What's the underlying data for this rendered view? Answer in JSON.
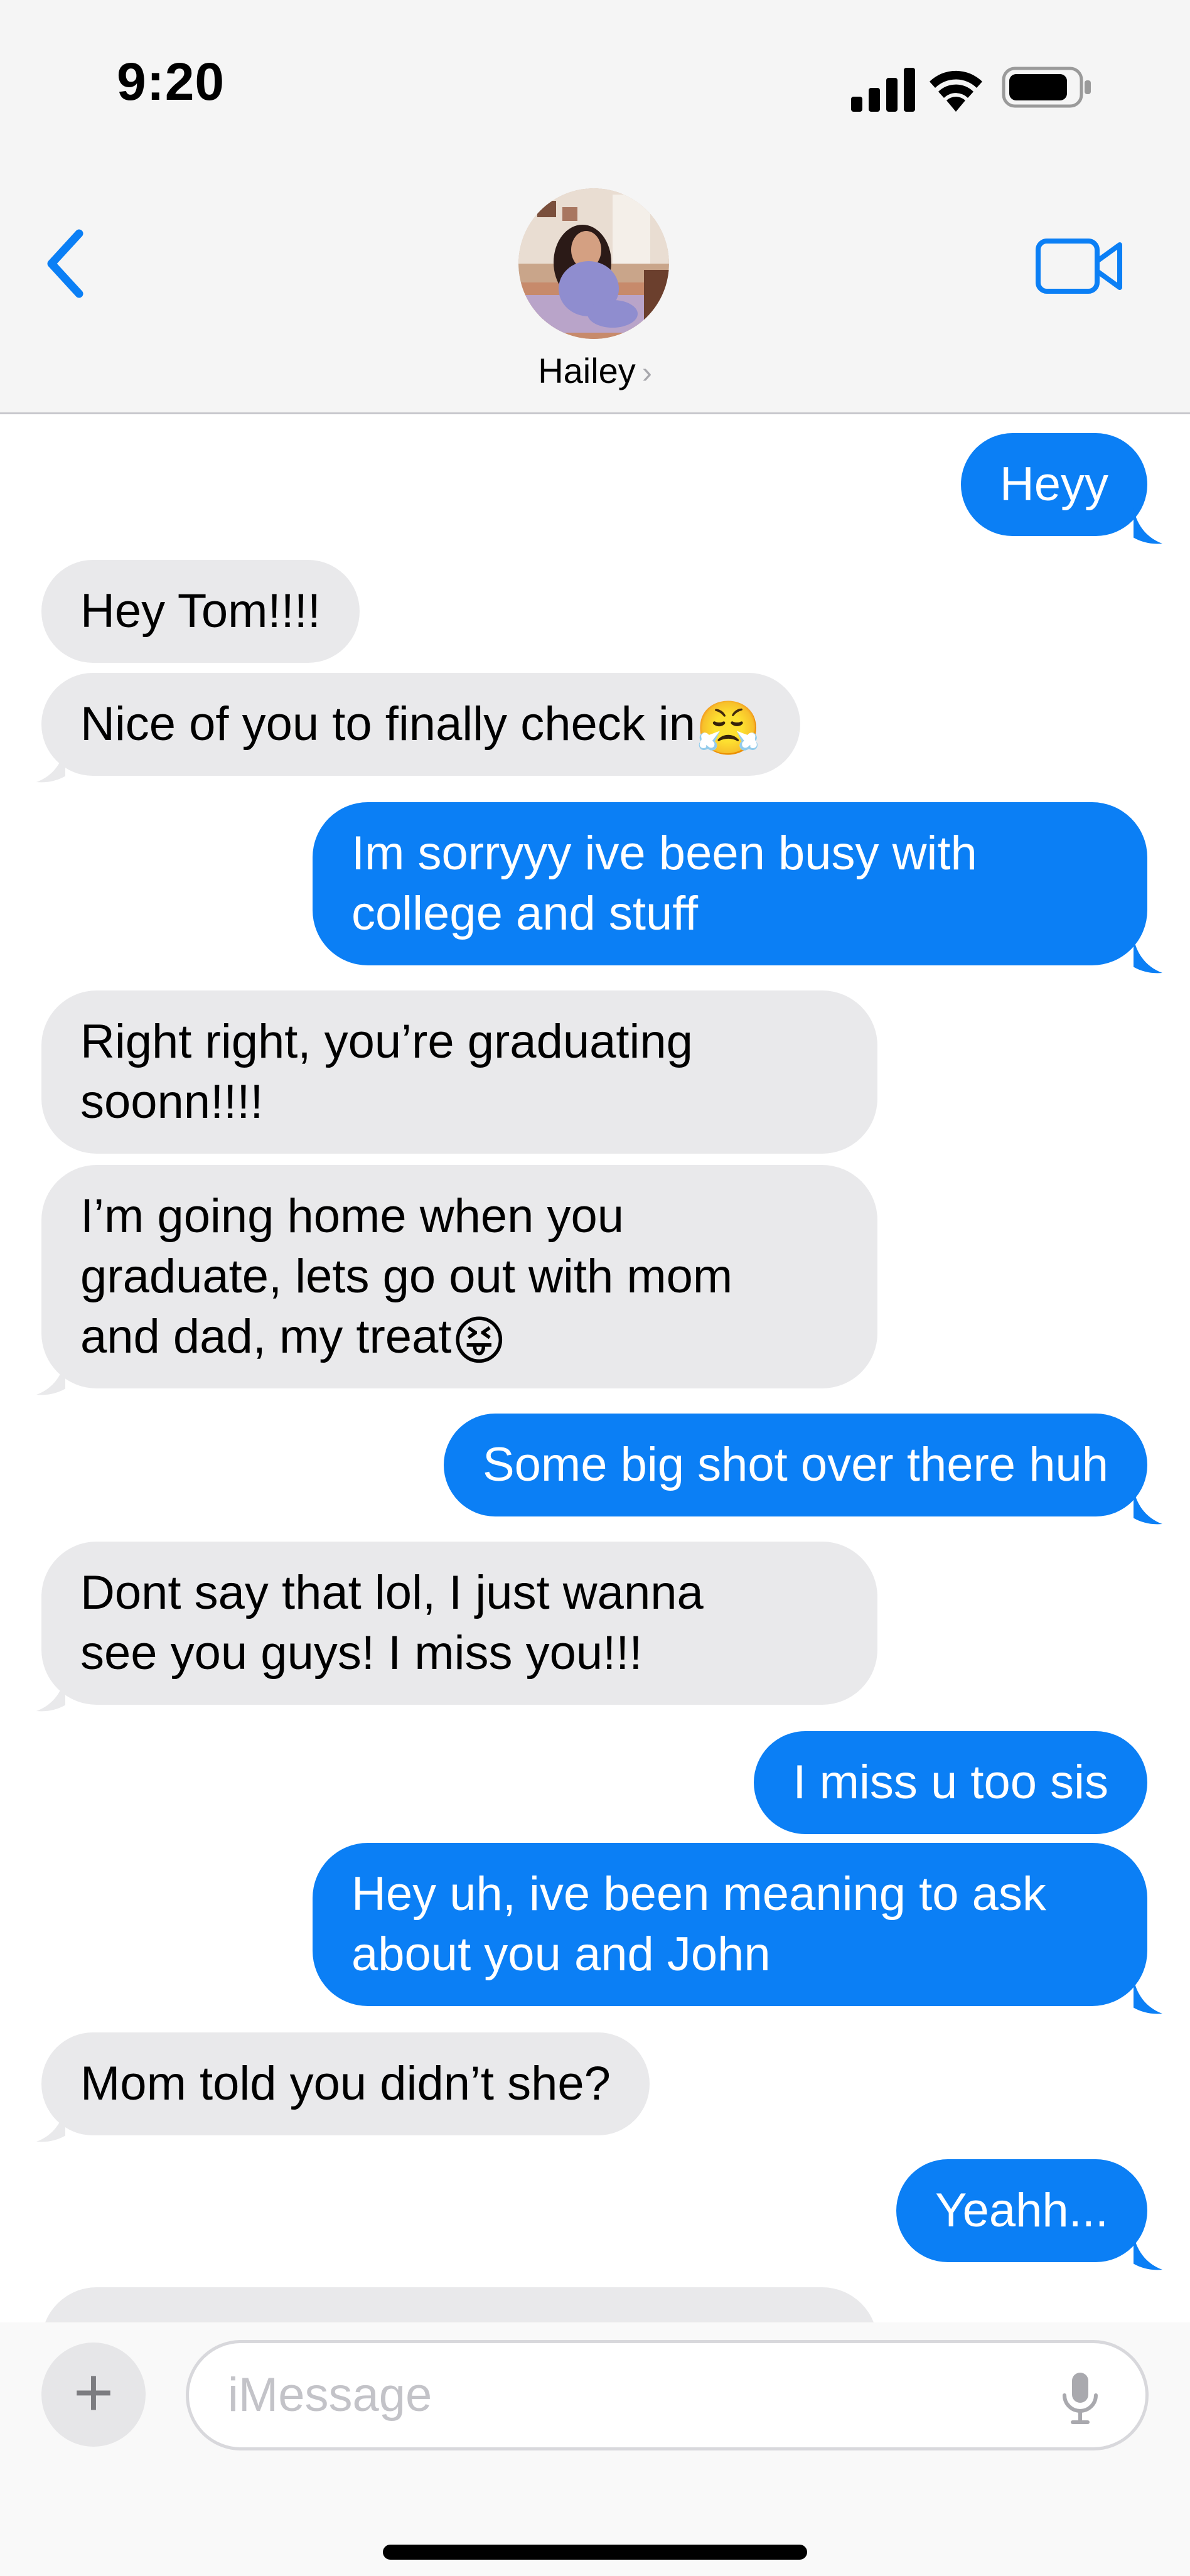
{
  "status_bar": {
    "time": "9:20",
    "icons": [
      "signal-icon",
      "wifi-icon",
      "battery-icon"
    ]
  },
  "header": {
    "back_icon": "chevron-left-icon",
    "contact_name": "Hailey",
    "contact_chevron": "›",
    "video_icon": "video-camera-icon"
  },
  "messages": [
    {
      "side": "sent",
      "text": "Heyy"
    },
    {
      "side": "received",
      "text": "Hey Tom!!!!"
    },
    {
      "side": "received",
      "text": "Nice of you to finally check in",
      "emoji": "😤"
    },
    {
      "side": "sent",
      "lines": [
        "Im sorryyy ive been busy with",
        "college and stuff"
      ]
    },
    {
      "side": "received",
      "lines": [
        "Right right, you’re graduating",
        "soonn!!!!"
      ]
    },
    {
      "side": "received",
      "lines": [
        "I’m going home when you",
        "graduate, lets go out with mom",
        "and dad, my treat"
      ],
      "emoji": "😝"
    },
    {
      "side": "sent",
      "text": "Some big shot over there huh"
    },
    {
      "side": "received",
      "lines": [
        "Dont say that lol, I just wanna",
        "see you guys! I miss you!!!"
      ]
    },
    {
      "side": "sent",
      "text": "I miss u too sis"
    },
    {
      "side": "sent",
      "lines": [
        "Hey uh, ive been meaning to ask",
        "about you and John"
      ]
    },
    {
      "side": "received",
      "text": "Mom told you didn’t she?"
    },
    {
      "side": "sent",
      "text": "Yeahh..."
    }
  ],
  "compose": {
    "plus_label": "+",
    "placeholder": "iMessage",
    "mic_icon": "microphone-icon"
  },
  "colors": {
    "sent_bubble": "#0b7ff5",
    "received_bubble": "#e9e9eb",
    "accent": "#0b7ff5",
    "header_bg": "#f5f5f5"
  }
}
